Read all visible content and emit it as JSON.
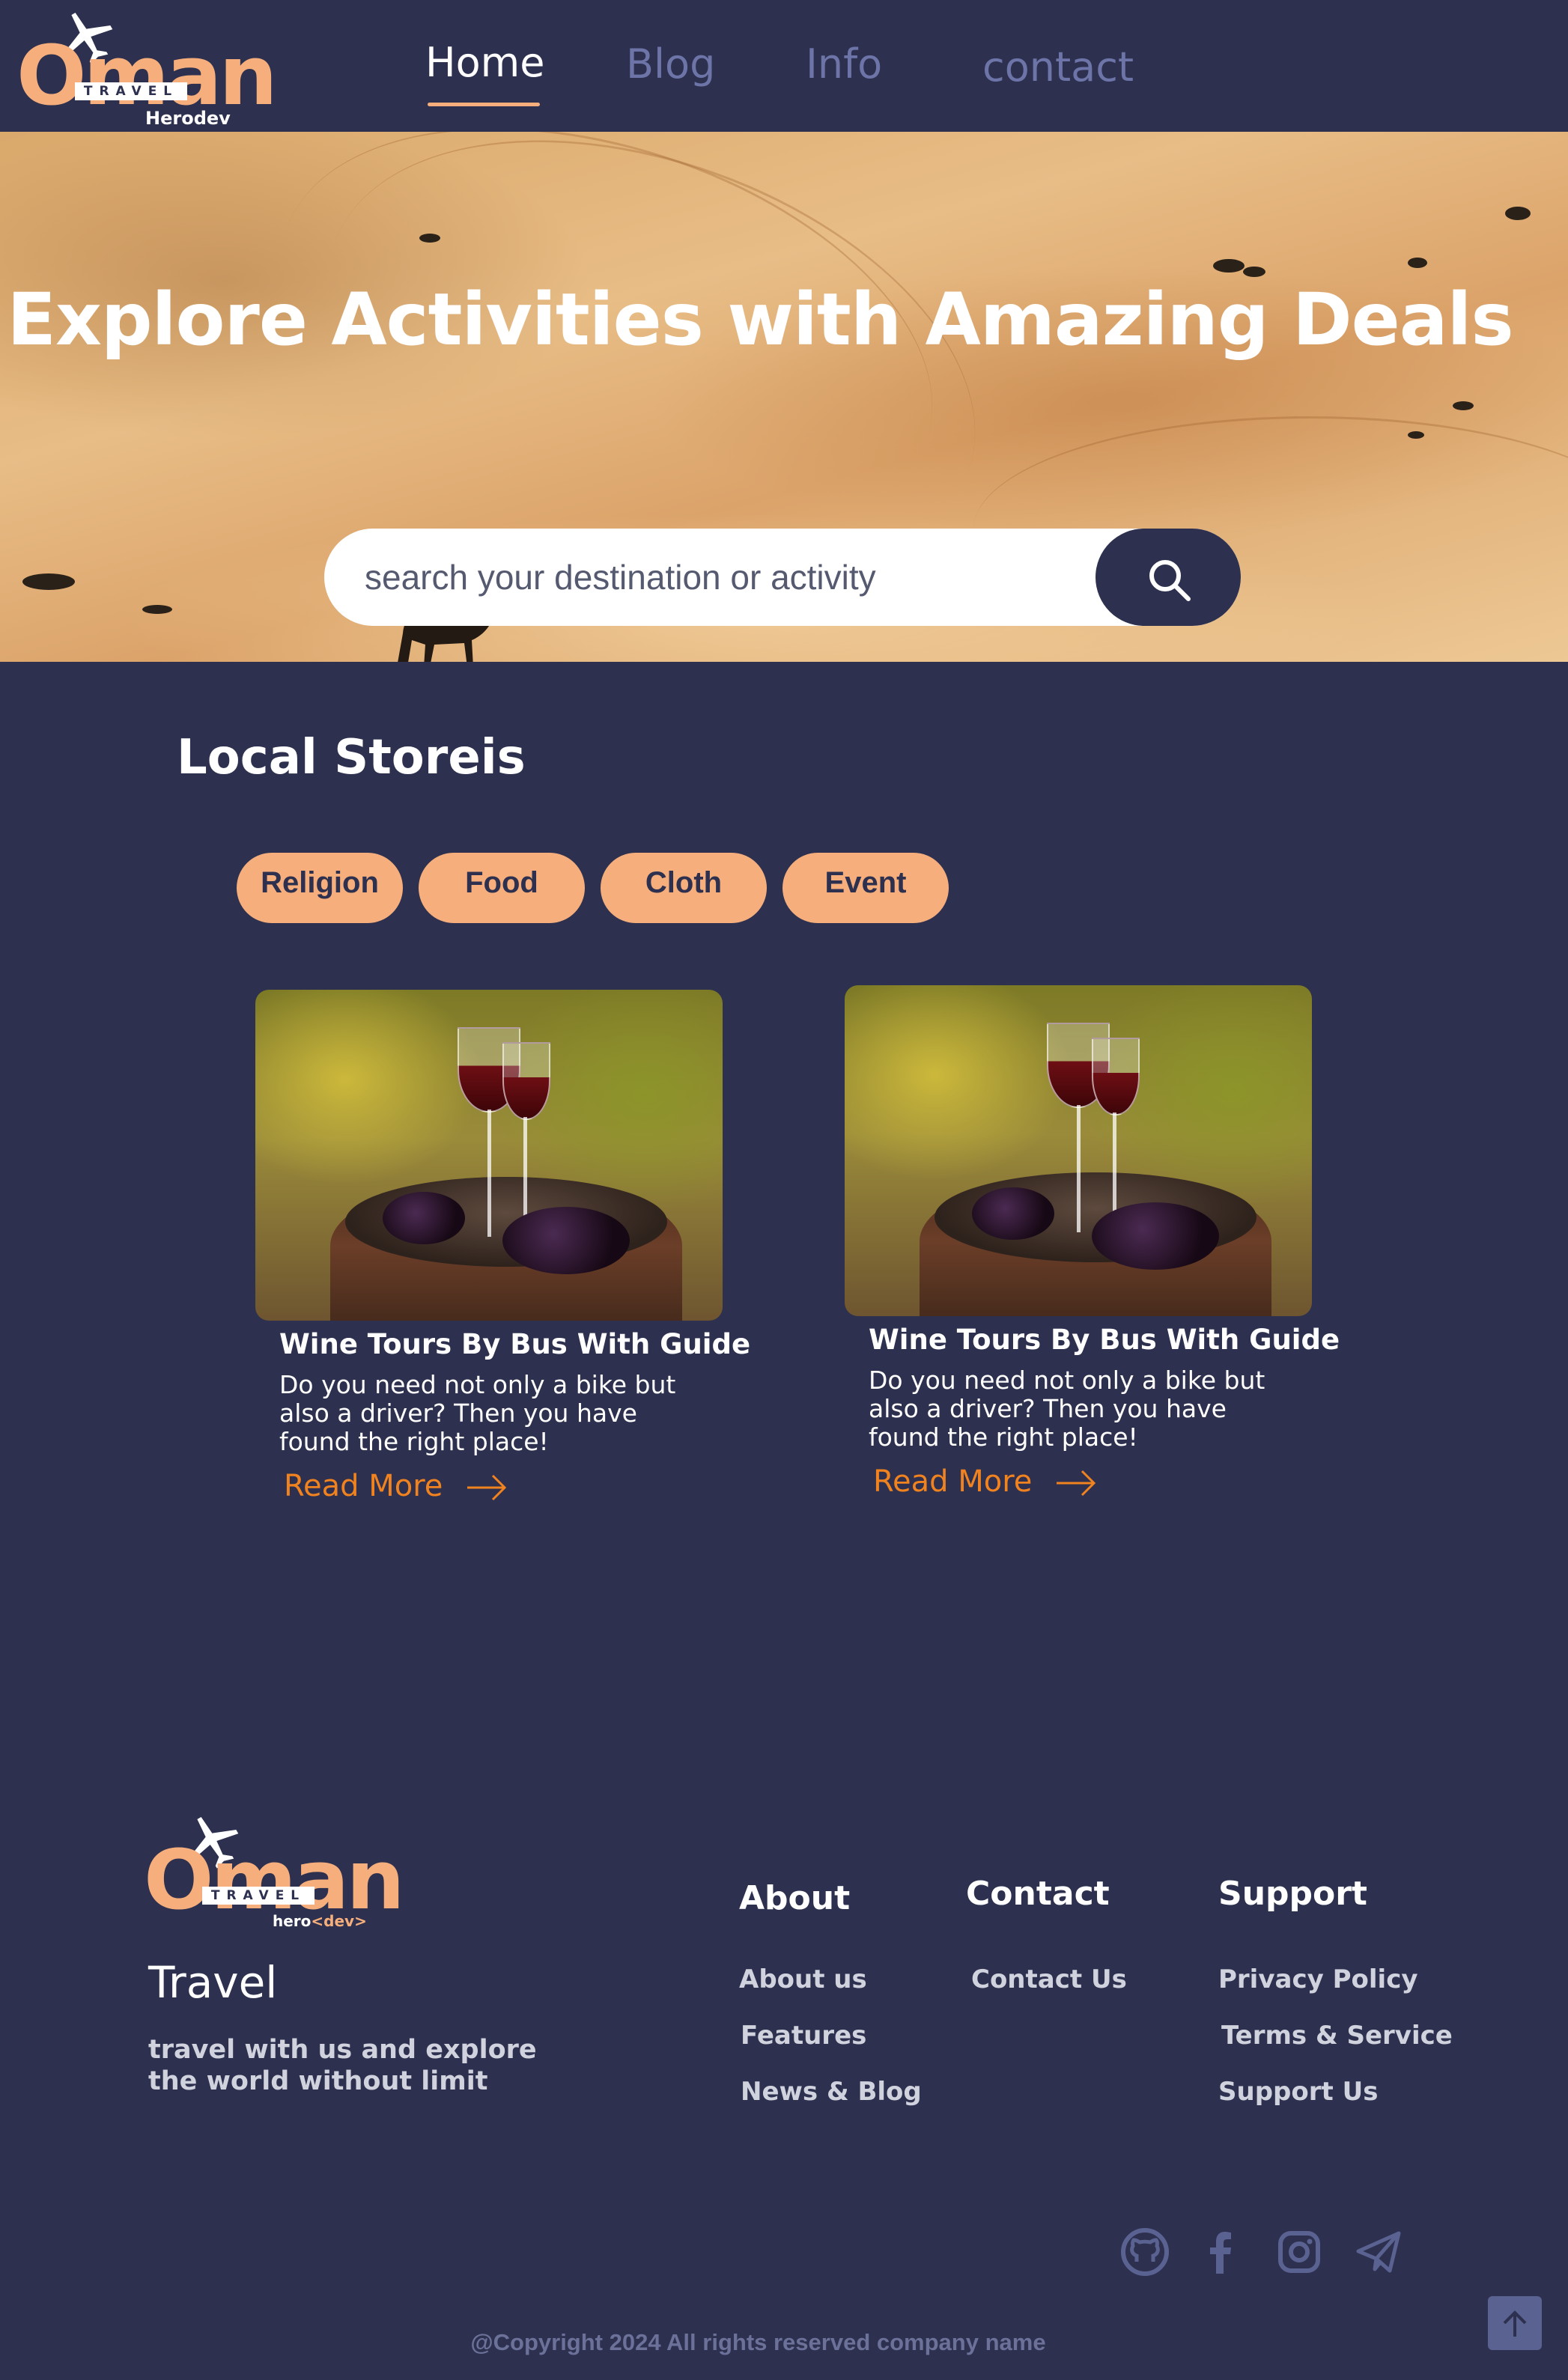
{
  "header": {
    "logo": {
      "word": "Oman",
      "band": "TRAVEL",
      "sub": "Herodev"
    },
    "nav": [
      {
        "label": "Home",
        "active": true
      },
      {
        "label": "Blog",
        "active": false
      },
      {
        "label": "Info",
        "active": false
      },
      {
        "label": "contact",
        "active": false
      }
    ]
  },
  "hero": {
    "title": "Explore Activities with Amazing Deals",
    "search_placeholder": "search your destination or activity",
    "search_icon": "search-icon"
  },
  "stories": {
    "title": "Local Storeis",
    "categories": [
      "Religion",
      "Food",
      "Cloth",
      "Event"
    ],
    "cards": [
      {
        "title": "Wine Tours By Bus With Guide",
        "description": "Do you need not only a bike but also a driver? Then you have found the right place!",
        "link": "Read More"
      },
      {
        "title": "Wine Tours By Bus With Guide",
        "description": "Do you need not only a bike but also a driver? Then you have found the right place!",
        "link": "Read More"
      }
    ]
  },
  "footer": {
    "logo": {
      "word": "Oman",
      "band": "TRAVEL",
      "sub_prefix": "hero",
      "sub_suffix": "<dev>"
    },
    "brand": "Travel",
    "tagline": "travel with us and explore the world without limit",
    "columns": [
      {
        "title": "About",
        "links": [
          "About us",
          "Features",
          "News & Blog"
        ]
      },
      {
        "title": "Contact",
        "links": [
          "Contact Us"
        ]
      },
      {
        "title": "Support",
        "links": [
          "Privacy Policy",
          "Terms & Service",
          "Support Us"
        ]
      }
    ],
    "social_icons": [
      "github-icon",
      "facebook-icon",
      "instagram-icon",
      "telegram-icon"
    ],
    "copyright": "@Copyright 2024 All rights reserved company name"
  },
  "colors": {
    "background": "#2d304e",
    "accent_peach": "#f6af7c",
    "link_orange": "#f0831f",
    "nav_muted": "#6d74a8"
  }
}
